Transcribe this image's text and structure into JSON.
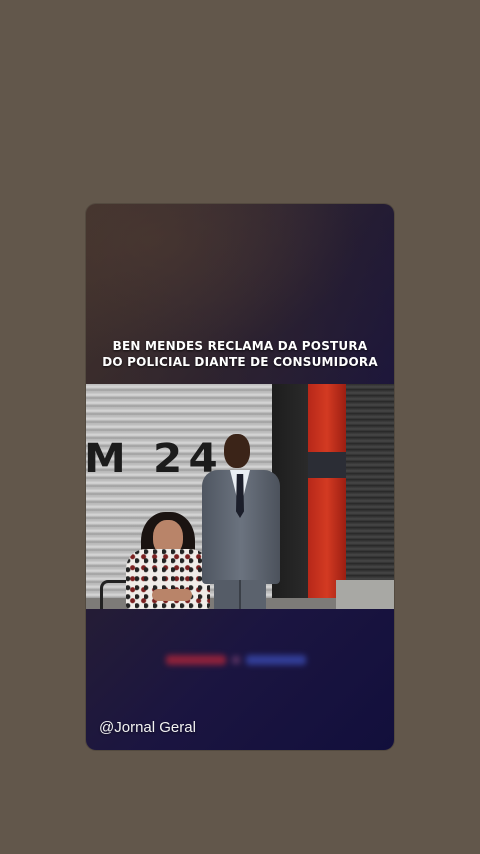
{
  "story": {
    "headline_line1": "BEN MENDES RECLAMA DA POSTURA",
    "headline_line2": "DO POLICIAL DIANTE DE CONSUMIDORA",
    "video_sign_text": "M 24",
    "handle": "@Jornal Geral"
  },
  "colors": {
    "page_background": "#62574b",
    "card_gradient_start": "#4a3b35",
    "card_gradient_end": "#120f3c",
    "headline_text": "#ffffff"
  },
  "icons": {
    "blurred_logo": "blurred-channel-logo"
  }
}
